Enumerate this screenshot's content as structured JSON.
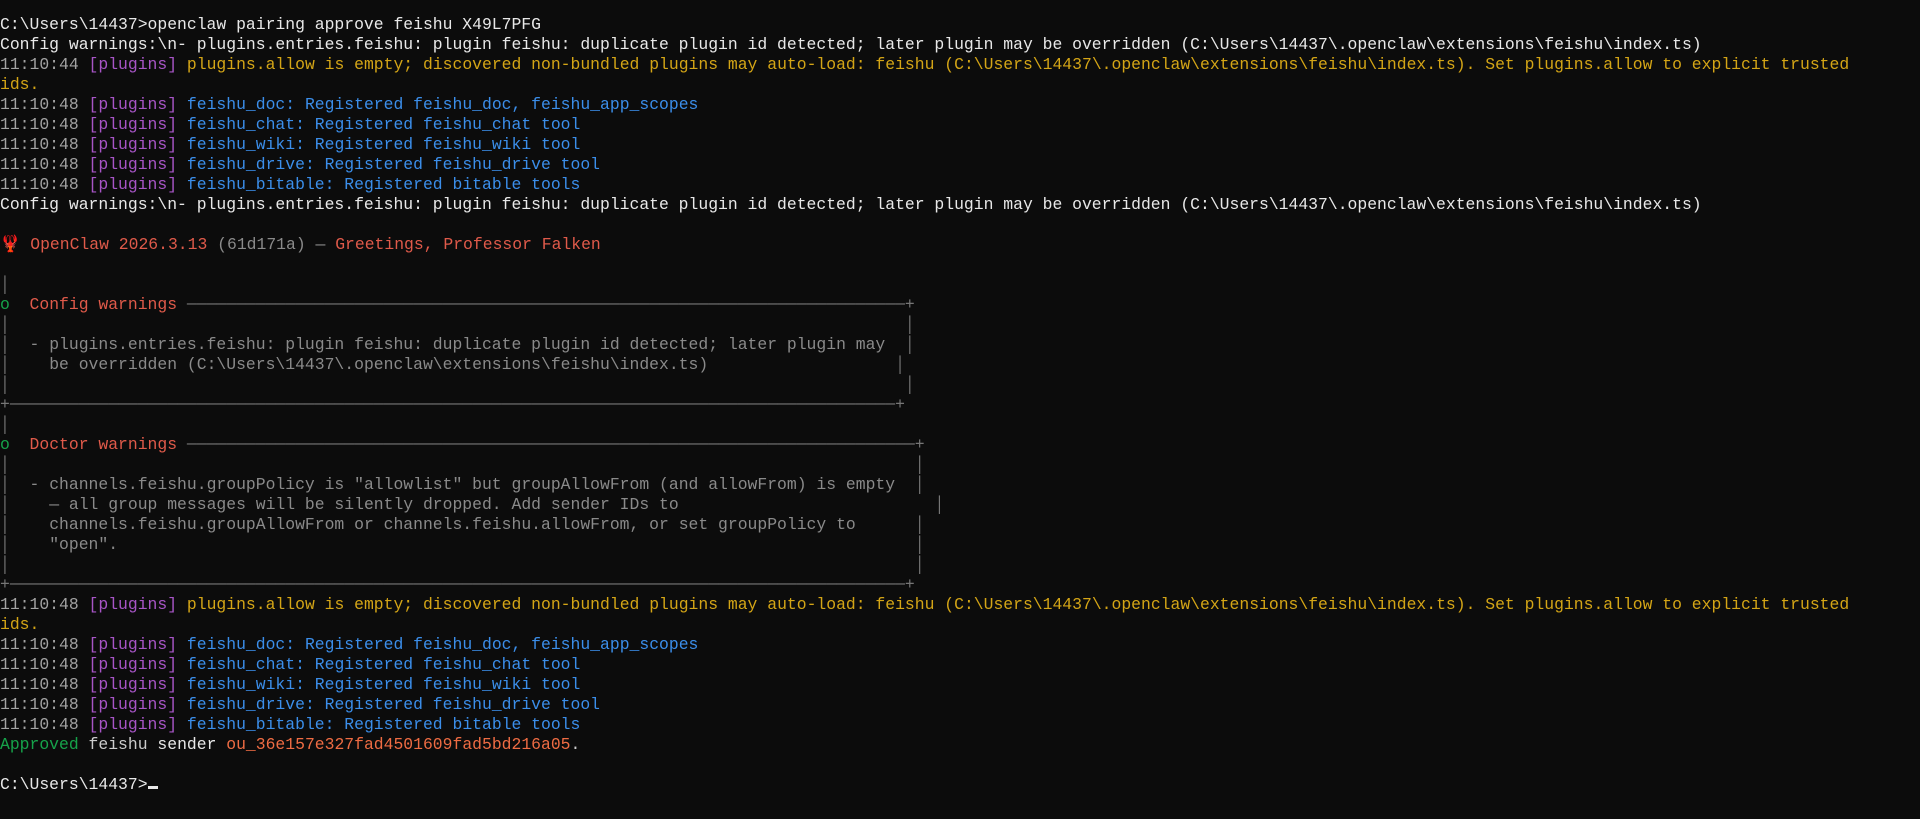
{
  "colors": {
    "background": "#0c0c0c",
    "default_text": "#cccccc",
    "timestamp": "#a3a3a3",
    "plugin_tag": "#a855c7",
    "plugin_info": "#3b8eea",
    "warning": "#d4a516",
    "success": "#16a34a",
    "heading": "#e05a4a",
    "sender_id": "#ef6c43",
    "box_text": "#8a8a8a"
  },
  "lines": [
    [
      {
        "t": "C:\\Users\\14437>openclaw pairing approve feishu X49L7PFG",
        "c": "white"
      }
    ],
    [
      {
        "t": "Config warnings:\\n- plugins.entries.feishu: plugin feishu: duplicate plugin id detected; later plugin may be overridden (C:\\Users\\14437\\.openclaw\\extensions\\feishu\\index.ts)",
        "c": "white"
      }
    ],
    [
      {
        "t": "11:10:44 ",
        "c": "time"
      },
      {
        "t": "[plugins] ",
        "c": "tag"
      },
      {
        "t": "plugins.allow is empty; discovered non-bundled plugins may auto-load: feishu (C:\\Users\\14437\\.openclaw\\extensions\\feishu\\index.ts). Set plugins.allow to explicit trusted",
        "c": "yellow"
      }
    ],
    [
      {
        "t": "ids.",
        "c": "yellow"
      }
    ],
    [
      {
        "t": "11:10:48 ",
        "c": "time"
      },
      {
        "t": "[plugins] ",
        "c": "tag"
      },
      {
        "t": "feishu_doc: Registered feishu_doc, feishu_app_scopes",
        "c": "blue"
      }
    ],
    [
      {
        "t": "11:10:48 ",
        "c": "time"
      },
      {
        "t": "[plugins] ",
        "c": "tag"
      },
      {
        "t": "feishu_chat: Registered feishu_chat tool",
        "c": "blue"
      }
    ],
    [
      {
        "t": "11:10:48 ",
        "c": "time"
      },
      {
        "t": "[plugins] ",
        "c": "tag"
      },
      {
        "t": "feishu_wiki: Registered feishu_wiki tool",
        "c": "blue"
      }
    ],
    [
      {
        "t": "11:10:48 ",
        "c": "time"
      },
      {
        "t": "[plugins] ",
        "c": "tag"
      },
      {
        "t": "feishu_drive: Registered feishu_drive tool",
        "c": "blue"
      }
    ],
    [
      {
        "t": "11:10:48 ",
        "c": "time"
      },
      {
        "t": "[plugins] ",
        "c": "tag"
      },
      {
        "t": "feishu_bitable: Registered bitable tools",
        "c": "blue"
      }
    ],
    [
      {
        "t": "Config warnings:\\n- plugins.entries.feishu: plugin feishu: duplicate plugin id detected; later plugin may be overridden (C:\\Users\\14437\\.openclaw\\extensions\\feishu\\index.ts)",
        "c": "white"
      }
    ],
    [],
    [
      {
        "t": "🦞 OpenClaw 2026.3.13 ",
        "c": "red"
      },
      {
        "t": "(61d171a)",
        "c": "gray"
      },
      {
        "t": " — ",
        "c": "gray"
      },
      {
        "t": "Greetings, Professor Falken",
        "c": "red"
      }
    ],
    [],
    [
      {
        "t": "│",
        "c": "border"
      }
    ],
    [
      {
        "t": "o  ",
        "c": "green"
      },
      {
        "t": "Config warnings ",
        "c": "red"
      },
      {
        "t": "─────────────────────────────────────────────────────────────────────────+",
        "c": "border"
      }
    ],
    [
      {
        "t": "│",
        "c": "border"
      },
      {
        "t": "                                                                                           │",
        "c": "border"
      }
    ],
    [
      {
        "t": "│  ",
        "c": "border"
      },
      {
        "t": "- plugins.entries.feishu: plugin feishu: duplicate plugin id detected; later plugin may",
        "c": "gray"
      },
      {
        "t": "  │",
        "c": "border"
      }
    ],
    [
      {
        "t": "│    ",
        "c": "border"
      },
      {
        "t": "be overridden (C:\\Users\\14437\\.openclaw\\extensions\\feishu\\index.ts)",
        "c": "gray"
      },
      {
        "t": "                   │",
        "c": "border"
      }
    ],
    [
      {
        "t": "│",
        "c": "border"
      },
      {
        "t": "                                                                                           │",
        "c": "border"
      }
    ],
    [
      {
        "t": "+──────────────────────────────────────────────────────────────────────────────────────────+",
        "c": "border"
      }
    ],
    [
      {
        "t": "│",
        "c": "border"
      }
    ],
    [
      {
        "t": "o  ",
        "c": "green"
      },
      {
        "t": "Doctor warnings ",
        "c": "red"
      },
      {
        "t": "──────────────────────────────────────────────────────────────────────────+",
        "c": "border"
      }
    ],
    [
      {
        "t": "│",
        "c": "border"
      },
      {
        "t": "                                                                                            │",
        "c": "border"
      }
    ],
    [
      {
        "t": "│  ",
        "c": "border"
      },
      {
        "t": "- channels.feishu.groupPolicy is \"allowlist\" but groupAllowFrom (and allowFrom) is empty",
        "c": "gray"
      },
      {
        "t": "  │",
        "c": "border"
      }
    ],
    [
      {
        "t": "│    ",
        "c": "border"
      },
      {
        "t": "— all group messages will be silently dropped. Add sender IDs to",
        "c": "gray"
      },
      {
        "t": "                          │",
        "c": "border"
      }
    ],
    [
      {
        "t": "│    ",
        "c": "border"
      },
      {
        "t": "channels.feishu.groupAllowFrom or channels.feishu.allowFrom, or set groupPolicy to",
        "c": "gray"
      },
      {
        "t": "      │",
        "c": "border"
      }
    ],
    [
      {
        "t": "│    ",
        "c": "border"
      },
      {
        "t": "\"open\".",
        "c": "gray"
      },
      {
        "t": "                                                                                 │",
        "c": "border"
      }
    ],
    [
      {
        "t": "│",
        "c": "border"
      },
      {
        "t": "                                                                                            │",
        "c": "border"
      }
    ],
    [
      {
        "t": "+───────────────────────────────────────────────────────────────────────────────────────────+",
        "c": "border"
      }
    ],
    [
      {
        "t": "11:10:48 ",
        "c": "time"
      },
      {
        "t": "[plugins] ",
        "c": "tag"
      },
      {
        "t": "plugins.allow is empty; discovered non-bundled plugins may auto-load: feishu (C:\\Users\\14437\\.openclaw\\extensions\\feishu\\index.ts). Set plugins.allow to explicit trusted",
        "c": "yellow"
      }
    ],
    [
      {
        "t": "ids.",
        "c": "yellow"
      }
    ],
    [
      {
        "t": "11:10:48 ",
        "c": "time"
      },
      {
        "t": "[plugins] ",
        "c": "tag"
      },
      {
        "t": "feishu_doc: Registered feishu_doc, feishu_app_scopes",
        "c": "blue"
      }
    ],
    [
      {
        "t": "11:10:48 ",
        "c": "time"
      },
      {
        "t": "[plugins] ",
        "c": "tag"
      },
      {
        "t": "feishu_chat: Registered feishu_chat tool",
        "c": "blue"
      }
    ],
    [
      {
        "t": "11:10:48 ",
        "c": "time"
      },
      {
        "t": "[plugins] ",
        "c": "tag"
      },
      {
        "t": "feishu_wiki: Registered feishu_wiki tool",
        "c": "blue"
      }
    ],
    [
      {
        "t": "11:10:48 ",
        "c": "time"
      },
      {
        "t": "[plugins] ",
        "c": "tag"
      },
      {
        "t": "feishu_drive: Registered feishu_drive tool",
        "c": "blue"
      }
    ],
    [
      {
        "t": "11:10:48 ",
        "c": "time"
      },
      {
        "t": "[plugins] ",
        "c": "tag"
      },
      {
        "t": "feishu_bitable: Registered bitable tools",
        "c": "blue"
      }
    ],
    [
      {
        "t": "Approved ",
        "c": "green"
      },
      {
        "t": "feishu ",
        "c": "default"
      },
      {
        "t": "sender ",
        "c": "white"
      },
      {
        "t": "ou_36e157e327fad4501609fad5bd216a05",
        "c": "orange"
      },
      {
        "t": ".",
        "c": "default"
      }
    ],
    [],
    [
      {
        "t": "C:\\Users\\14437>",
        "c": "white"
      },
      {
        "cursor": true
      }
    ]
  ]
}
